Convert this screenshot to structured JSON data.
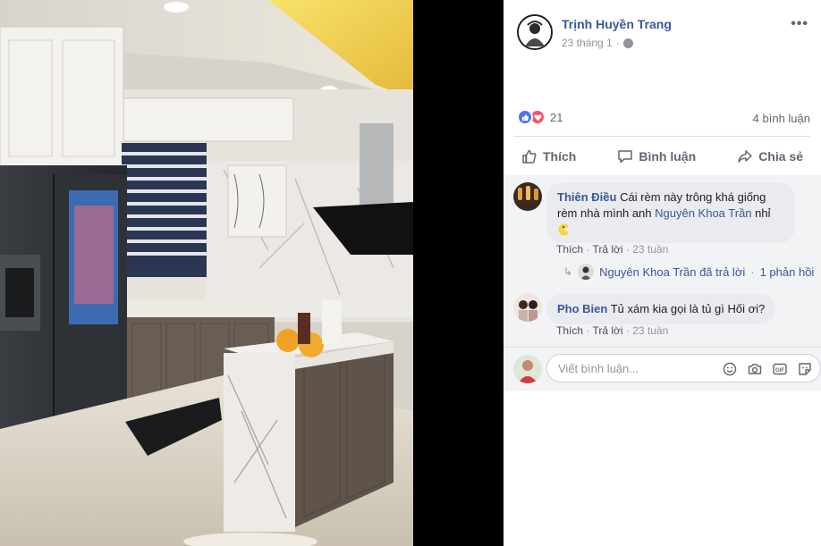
{
  "post": {
    "author": "Trịnh Huyền Trang",
    "date": "23 tháng 1",
    "reaction_count": "21",
    "comment_count": "4 bình luận"
  },
  "actions": {
    "like": "Thích",
    "comment": "Bình luận",
    "share": "Chia sẻ"
  },
  "comments": [
    {
      "name": "Thiên Điều",
      "text_before": "Cái rèm này trông khá giống rèm nhà mình anh ",
      "mention": "Nguyên Khoa Trần",
      "text_after": " nhỉ",
      "like": "Thích",
      "reply": "Trả lời",
      "time": "23 tuần",
      "reply_summary": {
        "text": "Nguyên Khoa Trần đã trả lời",
        "count": "1 phản hồi"
      }
    },
    {
      "name": "Pho Bien",
      "text": "Tủ xám kia gọi là tủ gì Hối ơi?",
      "like": "Thích",
      "reply": "Trả lời",
      "time": "23 tuần"
    }
  ],
  "composer": {
    "placeholder": "Viết bình luận..."
  },
  "icons": {
    "more": "more-icon",
    "globe": "globe-icon",
    "emoji": "emoji-icon",
    "camera": "camera-icon",
    "gif": "gif-icon",
    "sticker": "sticker-icon"
  },
  "colors": {
    "link": "#385898",
    "muted": "#90949c",
    "like_blue": "#4a76e8",
    "love_red": "#f25268"
  }
}
